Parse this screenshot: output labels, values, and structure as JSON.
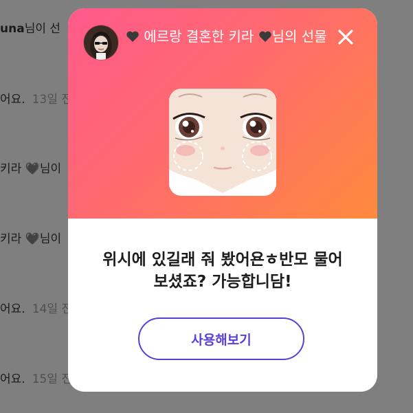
{
  "background_feed": [
    {
      "user": "una",
      "text": "님이 선"
    },
    {
      "text": "어요.",
      "time": "13일 전"
    },
    {
      "text": "키라 🖤님이"
    },
    {
      "text": "키라 🖤님이"
    },
    {
      "text": "어요.",
      "time": "14일 전"
    },
    {
      "text": "어요.",
      "time": "15일 전"
    }
  ],
  "modal": {
    "title_part1": "에르랑 결혼한 키라",
    "title_part2": "님의 선물",
    "message": "위시에 있길래 줘 봤어욘ㅎ반모 물어보셨죠? 가능합니담!",
    "use_button": "사용해보기"
  },
  "colors": {
    "gradient_start": "#ff5a8c",
    "gradient_end": "#ff8a3d",
    "button_accent": "#5a3fd6",
    "backdrop": "#7f7f7f"
  },
  "icons": [
    "black-heart-icon",
    "close-icon",
    "avatar",
    "face-gift-image"
  ]
}
